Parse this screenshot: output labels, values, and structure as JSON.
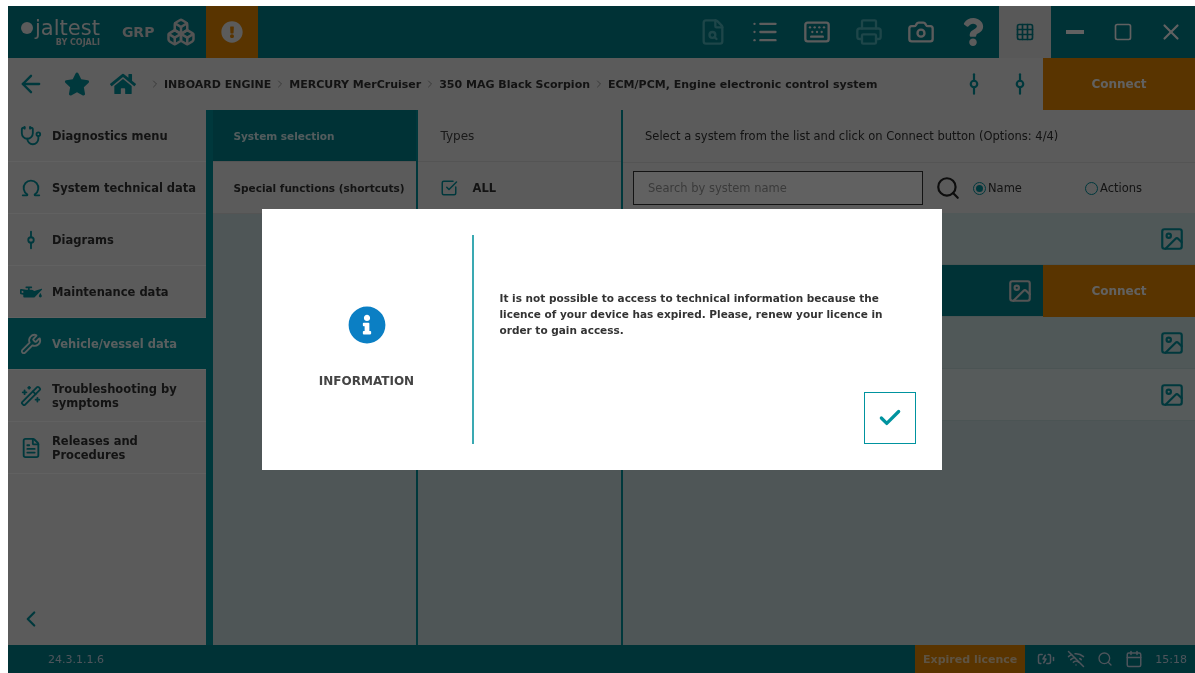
{
  "top_bar": {
    "logo": "jaltest",
    "logo_subtitle": "BY COJALI",
    "mode": "GRP",
    "toolbar": [
      {
        "kind": "document",
        "disabled": true
      },
      {
        "kind": "list",
        "disabled": false
      },
      {
        "kind": "keyboard",
        "disabled": false
      },
      {
        "kind": "printer",
        "disabled": true
      },
      {
        "kind": "camera",
        "disabled": false
      },
      {
        "kind": "help",
        "disabled": false
      },
      {
        "kind": "apps",
        "disabled": false
      }
    ]
  },
  "breadcrumb": [
    "INBOARD ENGINE",
    "MERCURY MerCruiser",
    "350 MAG Black Scorpion",
    "ECM/PCM, Engine electronic control system"
  ],
  "connect_button": "Connect",
  "sidebar": {
    "items": [
      {
        "label": "Diagnostics menu",
        "selected": false
      },
      {
        "label": "System technical data",
        "selected": false
      },
      {
        "label": "Diagrams",
        "selected": false
      },
      {
        "label": "Maintenance data",
        "selected": false
      },
      {
        "label": "Vehicle/vessel data",
        "selected": true
      },
      {
        "label": "Troubleshooting by symptoms",
        "selected": false
      },
      {
        "label": "Releases and Procedures",
        "selected": false
      }
    ]
  },
  "tabs": [
    {
      "label": "System selection",
      "selected": true
    },
    {
      "label": "Special functions (shortcuts)",
      "selected": false
    }
  ],
  "types": {
    "header": "Types",
    "items": [
      {
        "label": "ALL",
        "checked": true
      }
    ]
  },
  "systems": {
    "instruction": "Select a system from the list and click on Connect button (Options: 4/4)",
    "search": {
      "placeholder": "Search by system name"
    },
    "search_by": [
      {
        "label": "Name",
        "selected": true
      },
      {
        "label": "Actions",
        "selected": false
      }
    ],
    "rows": [
      {
        "selected": false
      },
      {
        "selected": true,
        "action": "Connect"
      },
      {
        "selected": false
      },
      {
        "selected": false
      }
    ]
  },
  "dialog": {
    "title": "INFORMATION",
    "message": "It is not possible to access to technical information because the licence of your device has expired. Please, renew your licence in order to gain access."
  },
  "status_bar": {
    "version": "24.3.1.1.6",
    "licence_status": "Expired licence",
    "time": "15:18"
  }
}
